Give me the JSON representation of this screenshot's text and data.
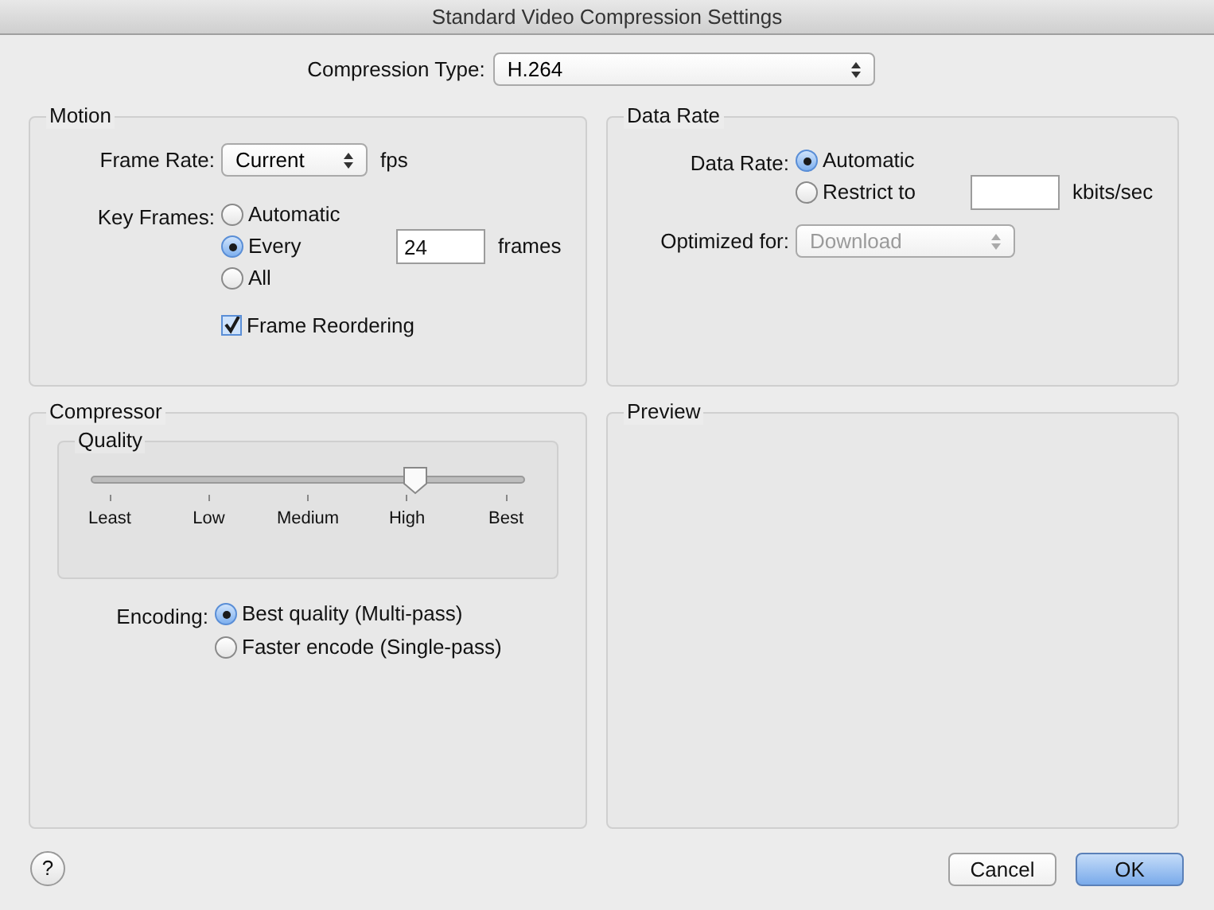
{
  "window": {
    "title": "Standard Video Compression Settings"
  },
  "compression_type": {
    "label": "Compression Type:",
    "value": "H.264"
  },
  "motion": {
    "title": "Motion",
    "frame_rate": {
      "label": "Frame Rate:",
      "value": "Current",
      "unit": "fps"
    },
    "key_frames": {
      "label": "Key Frames:",
      "options": [
        {
          "label": "Automatic",
          "selected": false,
          "kind": "plain"
        },
        {
          "label": "Every",
          "selected": true,
          "kind": "field",
          "value": "24",
          "unit": "frames"
        },
        {
          "label": "All",
          "selected": false,
          "kind": "plain"
        }
      ]
    },
    "frame_reordering": {
      "label": "Frame Reordering",
      "checked": true
    }
  },
  "data_rate": {
    "title": "Data Rate",
    "label": "Data Rate:",
    "options": [
      {
        "label": "Automatic",
        "selected": true,
        "kind": "plain"
      },
      {
        "label": "Restrict to",
        "selected": false,
        "kind": "field",
        "unit": "kbits/sec"
      }
    ],
    "optimized_for": {
      "label": "Optimized for:",
      "value": "Download",
      "disabled": true
    }
  },
  "compressor": {
    "title": "Compressor",
    "quality": {
      "title": "Quality",
      "level": 0.75,
      "ticks": [
        "Least",
        "Low",
        "Medium",
        "High",
        "Best"
      ]
    },
    "encoding": {
      "label": "Encoding:",
      "options": [
        {
          "label": "Best quality (Multi-pass)",
          "selected": true
        },
        {
          "label": "Faster encode (Single-pass)",
          "selected": false
        }
      ]
    }
  },
  "preview": {
    "title": "Preview"
  },
  "help": "?",
  "buttons": [
    {
      "label": "Cancel",
      "kind": "normal"
    },
    {
      "label": "OK",
      "kind": "default"
    }
  ]
}
